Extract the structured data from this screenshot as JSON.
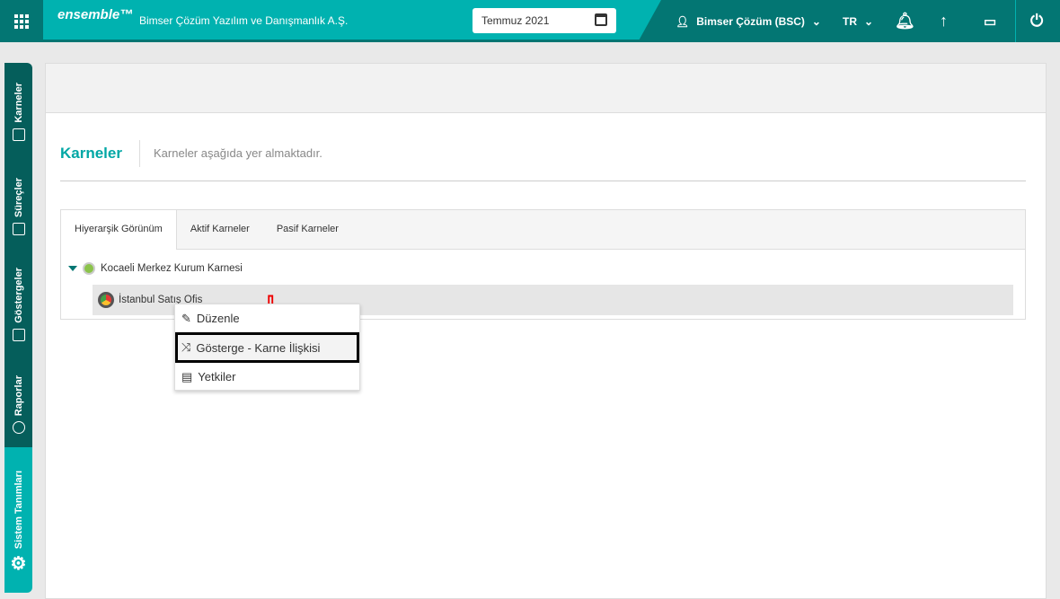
{
  "header": {
    "brand": "ensemble™",
    "company": "Bimser Çözüm Yazılım ve Danışmanlık A.Ş.",
    "date": "Temmuz 2021",
    "user": "Bimser Çözüm (BSC)",
    "lang": "TR"
  },
  "sidebar": {
    "items": [
      {
        "label": "Karneler"
      },
      {
        "label": "Süreçler"
      },
      {
        "label": "Göstergeler"
      },
      {
        "label": "Raporlar"
      },
      {
        "label": "Sistem Tanımları"
      }
    ]
  },
  "page": {
    "title": "Karneler",
    "subtitle": "Karneler aşağıda yer almaktadır."
  },
  "tabs": [
    {
      "label": "Hiyerarşik Görünüm"
    },
    {
      "label": "Aktif Karneler"
    },
    {
      "label": "Pasif Karneler"
    }
  ],
  "tree": {
    "root": "Kocaeli Merkez Kurum Karnesi",
    "child": "İstanbul Satış Ofis"
  },
  "context_menu": [
    {
      "label": "Düzenle"
    },
    {
      "label": "Gösterge - Karne İlişkisi"
    },
    {
      "label": "Yetkiler"
    }
  ],
  "annotation": {
    "arrow": "⇩"
  }
}
